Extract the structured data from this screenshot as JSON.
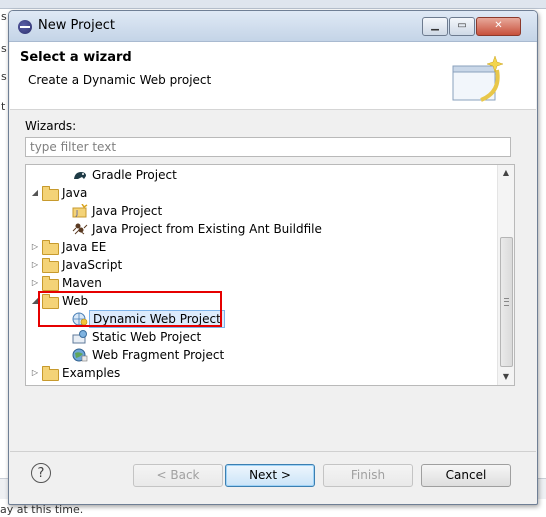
{
  "window": {
    "title": "New Project"
  },
  "header": {
    "title": "Select a wizard",
    "description": "Create a Dynamic Web project"
  },
  "wizards_label": "Wizards:",
  "filter": {
    "placeholder": "type filter text",
    "value": ""
  },
  "tree": {
    "gradle_project": "Gradle Project",
    "java": "Java",
    "java_project": "Java Project",
    "java_project_ant": "Java Project from Existing Ant Buildfile",
    "java_ee": "Java EE",
    "javascript": "JavaScript",
    "maven": "Maven",
    "web": "Web",
    "dynamic_web_project": "Dynamic Web Project",
    "static_web_project": "Static Web Project",
    "web_fragment_project": "Web Fragment Project",
    "examples": "Examples"
  },
  "buttons": {
    "help": "?",
    "back": "< Back",
    "next": "Next >",
    "finish": "Finish",
    "cancel": "Cancel"
  },
  "background": {
    "status_fragment": "ay at this time."
  },
  "colors": {
    "highlight_box": "#e60000",
    "selection": "#dcebfc"
  }
}
